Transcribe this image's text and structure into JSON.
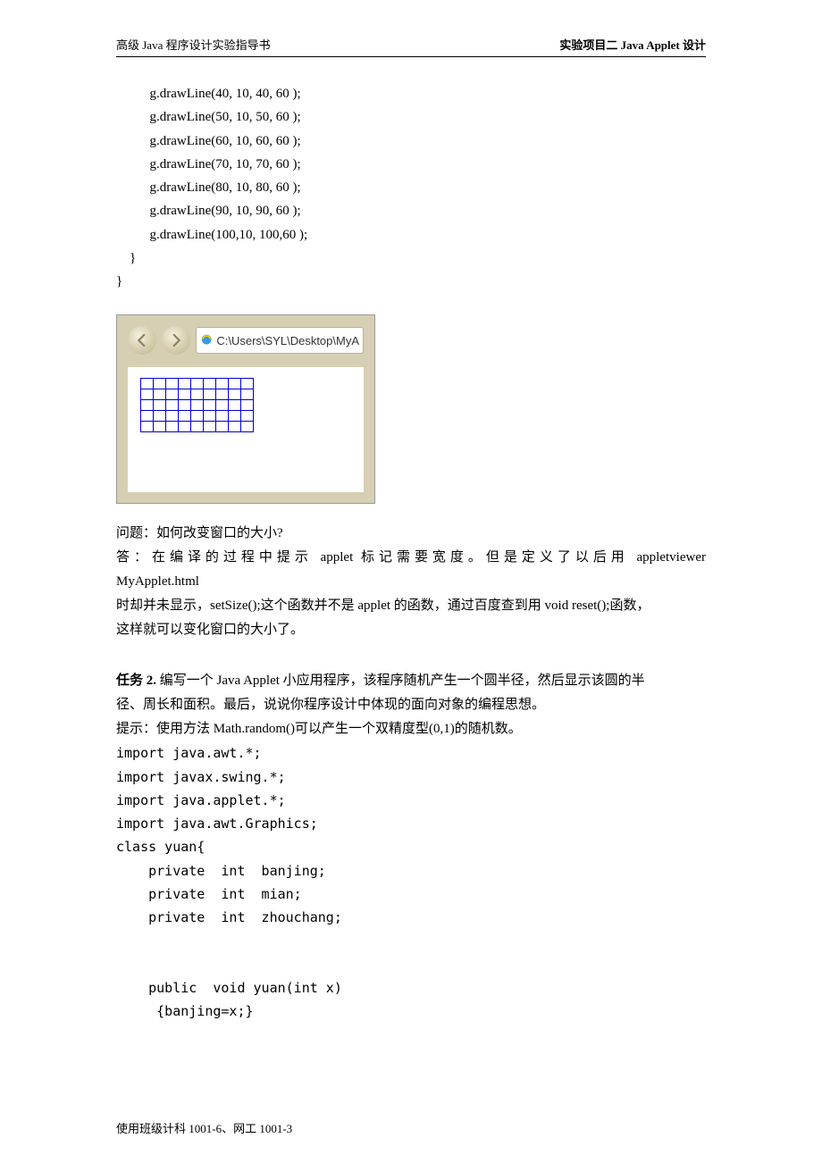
{
  "header": {
    "left": "高级 Java 程序设计实验指导书",
    "right": "实验项目二    Java Applet 设计"
  },
  "code": {
    "l1": "          g.drawLine(40, 10, 40, 60 );",
    "l2": "          g.drawLine(50, 10, 50, 60 );",
    "l3": "          g.drawLine(60, 10, 60, 60 );",
    "l4": "          g.drawLine(70, 10, 70, 60 );",
    "l5": "          g.drawLine(80, 10, 80, 60 );",
    "l6": "          g.drawLine(90, 10, 90, 60 );",
    "l7": "          g.drawLine(100,10, 100,60 );",
    "l8": "    }",
    "l9": "}"
  },
  "browser": {
    "address": "C:\\Users\\SYL\\Desktop\\MyA"
  },
  "q": {
    "question": "问题：如何改变窗口的大小?",
    "a1": "答：在编译的过程中提示 applet 标记需要宽度。但是定义了以后用 appletviewer",
    "a2": "MyApplet.html",
    "a3": "时却并未显示，setSize();这个函数并不是 applet 的函数，通过百度查到用 void reset();函数，",
    "a4": "这样就可以变化窗口的大小了。"
  },
  "task2": {
    "label": "任务 2. ",
    "p1": "编写一个 Java Applet 小应用程序，该程序随机产生一个圆半径，然后显示该圆的半",
    "p2": "径、周长和面积。最后，说说你程序设计中体现的面向对象的编程思想。",
    "p3": "提示：使用方法 Math.random()可以产生一个双精度型(0,1)的随机数。",
    "c1": "import java.awt.*;",
    "c2": "import javax.swing.*;",
    "c3": "import java.applet.*;",
    "c4": "import java.awt.Graphics;",
    "c5": "class yuan{",
    "c6": "    private  int  banjing;",
    "c7": "    private  int  mian;",
    "c8": "    private  int  zhouchang;",
    "c9": "",
    "c10": "",
    "c11": "    public  void yuan(int x)",
    "c12": "     {banjing=x;}"
  },
  "footer": "使用班级计科 1001-6、网工 1001-3"
}
